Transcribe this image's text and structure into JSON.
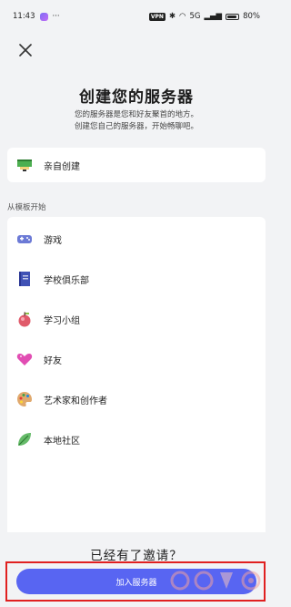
{
  "status_bar": {
    "time": "11:43",
    "more": "···",
    "vpn": "VPN",
    "network": "5G",
    "battery": "80%"
  },
  "header": {
    "title": "创建您的服务器",
    "subtitle_line1": "您的服务器是您和好友聚首的地方。",
    "subtitle_line2": "创建您自己的服务器，开始畅聊吧。"
  },
  "create_option": {
    "label": "亲自创建",
    "icon": "pixel-pencil-icon"
  },
  "templates": {
    "section_label": "从模板开始",
    "items": [
      {
        "label": "游戏",
        "icon": "gamepad-icon"
      },
      {
        "label": "学校俱乐部",
        "icon": "book-icon"
      },
      {
        "label": "学习小组",
        "icon": "apple-icon"
      },
      {
        "label": "好友",
        "icon": "heart-icon"
      },
      {
        "label": "艺术家和创作者",
        "icon": "palette-icon"
      },
      {
        "label": "本地社区",
        "icon": "leaf-icon"
      }
    ]
  },
  "footer": {
    "invite_question": "已经有了邀请？",
    "join_button": "加入服务器"
  },
  "colors": {
    "accent": "#5865f2",
    "background": "#f2f3f5",
    "highlight_frame": "#e02020"
  }
}
